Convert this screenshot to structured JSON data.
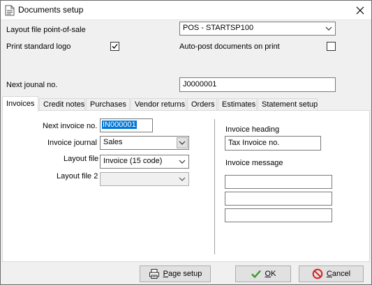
{
  "window": {
    "title": "Documents setup"
  },
  "upper": {
    "layout_pos_label": "Layout file point-of-sale",
    "layout_pos_value": "POS - STARTSP100",
    "print_logo_label": "Print standard logo",
    "print_logo_checked": true,
    "autopost_label": "Auto-post documents on print",
    "autopost_checked": false,
    "next_journal_label": "Next jounal no.",
    "next_journal_value": "J0000001"
  },
  "tabs": [
    "Invoices",
    "Credit notes",
    "Purchases",
    "Vendor returns",
    "Orders",
    "Estimates",
    "Statement setup"
  ],
  "invoices": {
    "next_invoice_label": "Next invoice no.",
    "next_invoice_value": "IN000001",
    "invoice_journal_label": "Invoice journal",
    "invoice_journal_value": "Sales",
    "layout_file_label": "Layout file",
    "layout_file_value": "Invoice (15 code)",
    "layout_file2_label": "Layout file 2",
    "layout_file2_value": "",
    "invoice_heading_label": "Invoice heading",
    "invoice_heading_value": "Tax Invoice no.",
    "invoice_message_label": "Invoice message",
    "invoice_message_lines": [
      "",
      "",
      ""
    ]
  },
  "buttons": {
    "page_setup_prefix": "",
    "page_setup_u": "P",
    "page_setup_rest": "age setup",
    "ok_u": "O",
    "ok_rest": "K",
    "cancel_u": "C",
    "cancel_rest": "ancel"
  },
  "icons": {
    "app": "document-icon",
    "close": "close-icon",
    "page_setup": "printer-icon",
    "ok": "checkmark-icon",
    "cancel": "no-entry-icon"
  },
  "colors": {
    "selection": "#0078d7",
    "ok_green": "#3a9a2a",
    "cancel_red": "#d42020"
  }
}
